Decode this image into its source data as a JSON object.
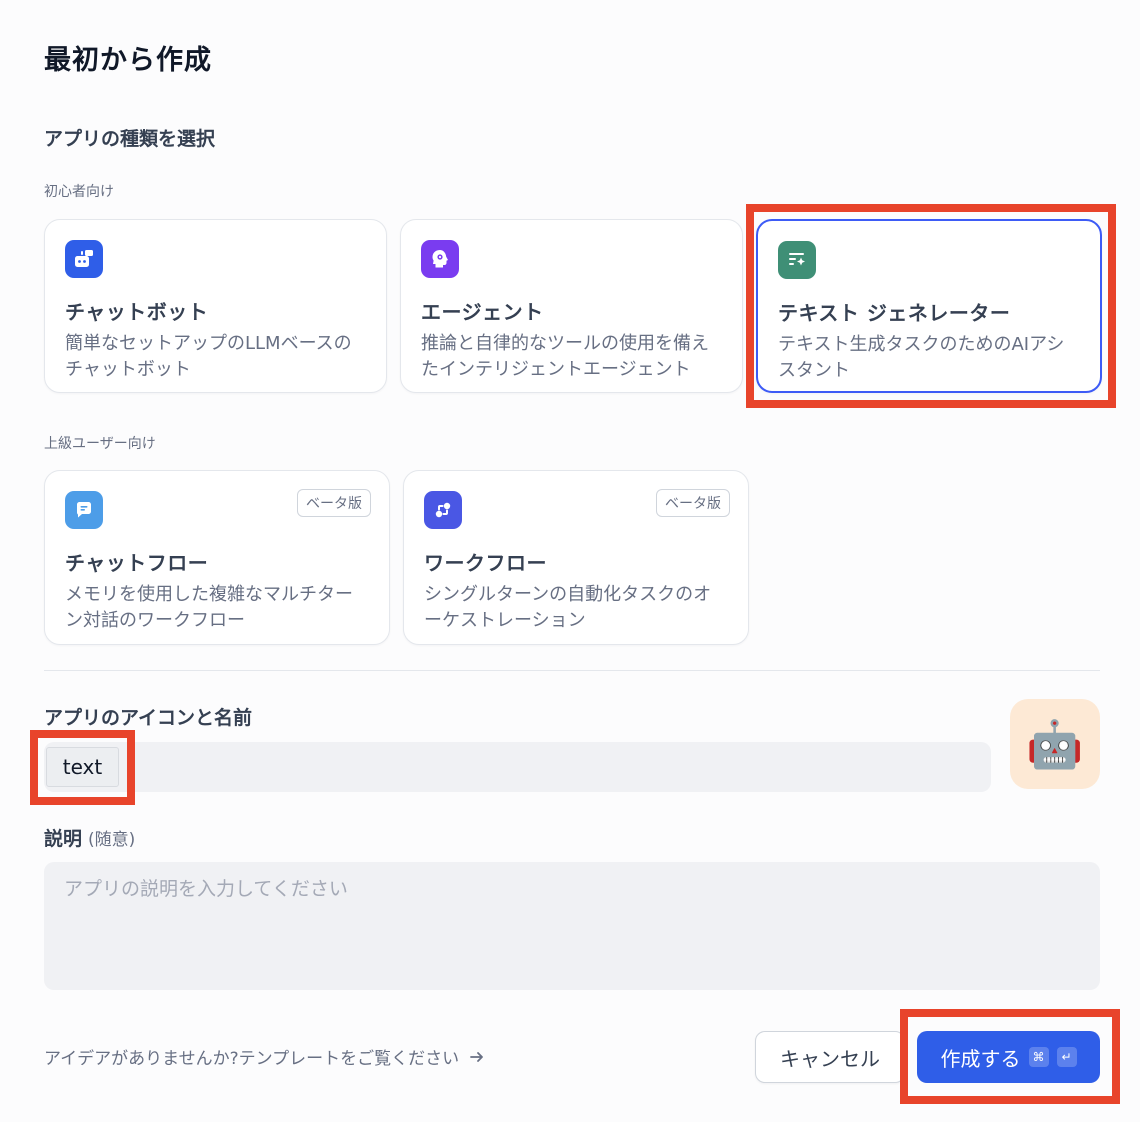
{
  "title": "最初から作成",
  "app_type": {
    "heading": "アプリの種類を選択",
    "beginner_label": "初心者向け",
    "advanced_label": "上級ユーザー向け",
    "beginner_cards": [
      {
        "title": "チャットボット",
        "desc": "簡単なセットアップのLLMベースのチャットボット",
        "icon": "chat-bot-icon",
        "color": "#2f5ee8"
      },
      {
        "title": "エージェント",
        "desc": "推論と自律的なツールの使用を備えたインテリジェントエージェント",
        "icon": "agent-icon",
        "color": "#7a3cf0"
      },
      {
        "title": "テキスト ジェネレーター",
        "desc": "テキスト生成タスクのためのAIアシスタント",
        "icon": "text-generator-icon",
        "color": "#3f8f76"
      }
    ],
    "advanced_cards": [
      {
        "title": "チャットフロー",
        "desc": "メモリを使用した複雑なマルチターン対話のワークフロー",
        "icon": "chatflow-icon",
        "color": "#4d9de8",
        "badge": "ベータ版"
      },
      {
        "title": "ワークフロー",
        "desc": "シングルターンの自動化タスクのオーケストレーション",
        "icon": "workflow-icon",
        "color": "#4a57e4",
        "badge": "ベータ版"
      }
    ]
  },
  "icon_name": {
    "label": "アプリのアイコンと名前",
    "value": "text",
    "app_icon": "🤖"
  },
  "description": {
    "label": "説明",
    "optional": "(随意)",
    "placeholder": "アプリの説明を入力してください"
  },
  "footer": {
    "template_link": "アイデアがありませんか?テンプレートをご覧ください",
    "cancel": "キャンセル",
    "create": "作成する",
    "shortcut_cmd": "⌘",
    "shortcut_enter": "↵"
  },
  "colors": {
    "accent": "#2f5ee8",
    "selected_border": "#3d5bf6",
    "highlight": "#e8442b"
  }
}
